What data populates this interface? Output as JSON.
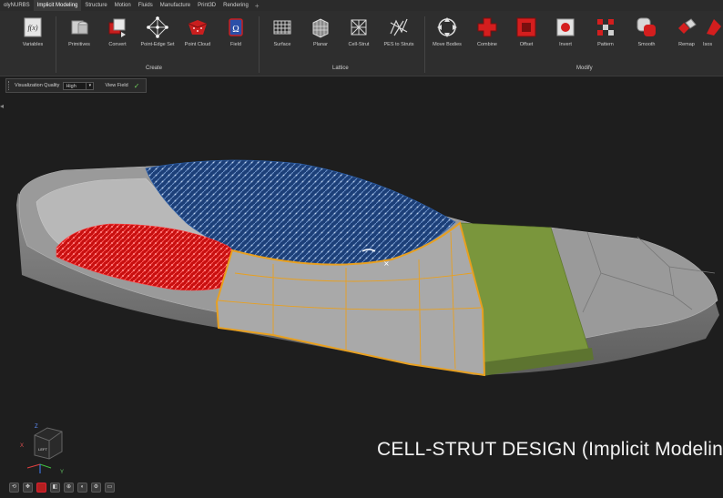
{
  "menu": {
    "tabs": [
      "olyNURBS",
      "Implicit Modeling",
      "Structure",
      "Motion",
      "Fluids",
      "Manufacture",
      "Print3D",
      "Rendering"
    ],
    "active_index": 1
  },
  "ribbon": {
    "tools": [
      {
        "label": "Variables",
        "icon": "variables-icon"
      },
      {
        "label": "Primitives",
        "icon": "primitives-icon"
      },
      {
        "label": "Convert",
        "icon": "convert-icon"
      },
      {
        "label": "Point-Edge Set",
        "icon": "point-edge-set-icon"
      },
      {
        "label": "Point Cloud",
        "icon": "point-cloud-icon"
      },
      {
        "label": "Field",
        "icon": "field-icon"
      },
      {
        "label": "Surface",
        "icon": "surface-lattice-icon"
      },
      {
        "label": "Planar",
        "icon": "planar-lattice-icon"
      },
      {
        "label": "Cell-Strut",
        "icon": "cell-strut-icon"
      },
      {
        "label": "PES to Struts",
        "icon": "pes-to-struts-icon"
      },
      {
        "label": "Move Bodies",
        "icon": "move-bodies-icon"
      },
      {
        "label": "Combine",
        "icon": "combine-icon"
      },
      {
        "label": "Offset",
        "icon": "offset-icon"
      },
      {
        "label": "Invert",
        "icon": "invert-icon"
      },
      {
        "label": "Pattern",
        "icon": "pattern-icon"
      },
      {
        "label": "Smooth",
        "icon": "smooth-icon"
      },
      {
        "label": "Remap",
        "icon": "remap-icon"
      },
      {
        "label": "Isos",
        "icon": "isosurface-icon"
      }
    ],
    "groups": [
      "Create",
      "Lattice",
      "Modify"
    ]
  },
  "options": {
    "quality_label": "Visualization Quality",
    "quality_value": "High",
    "view_field_label": "View Field"
  },
  "viewport": {
    "caption": "CELL-STRUT DESIGN (Implicit Modeling)",
    "viewcube_label": "LEFT",
    "axes": {
      "x": "X",
      "y": "Y",
      "z": "Z"
    }
  },
  "colors": {
    "background": "#1e1e1e",
    "insole": "#9a9a9a",
    "heel_lattice": "#d61414",
    "arch_lattice": "#1f4f8f",
    "forefoot_band": "#7a963c",
    "selection": "#e8a020"
  }
}
